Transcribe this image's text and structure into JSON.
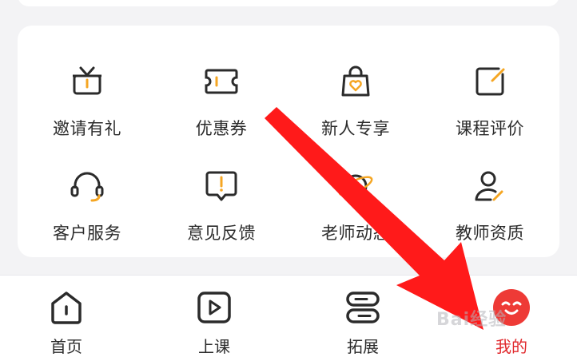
{
  "services": [
    {
      "label": "邀请有礼",
      "icon": "gift-icon"
    },
    {
      "label": "优惠券",
      "icon": "coupon-icon"
    },
    {
      "label": "新人专享",
      "icon": "shopping-bag-heart-icon"
    },
    {
      "label": "课程评价",
      "icon": "edit-square-icon"
    },
    {
      "label": "客户服务",
      "icon": "headset-icon"
    },
    {
      "label": "意见反馈",
      "icon": "feedback-icon"
    },
    {
      "label": "老师动态",
      "icon": "planet-icon"
    },
    {
      "label": "教师资质",
      "icon": "user-certificate-icon"
    }
  ],
  "tabbar": {
    "home": "首页",
    "lessons": "上课",
    "expand": "拓展",
    "mine": "我的",
    "active": "mine"
  },
  "watermark": "Bai经验",
  "colors": {
    "accent": "#f5a623",
    "icon_stroke": "#2b2b2b",
    "active_tab": "#e0282c",
    "arrow": "#ff1a1a"
  }
}
